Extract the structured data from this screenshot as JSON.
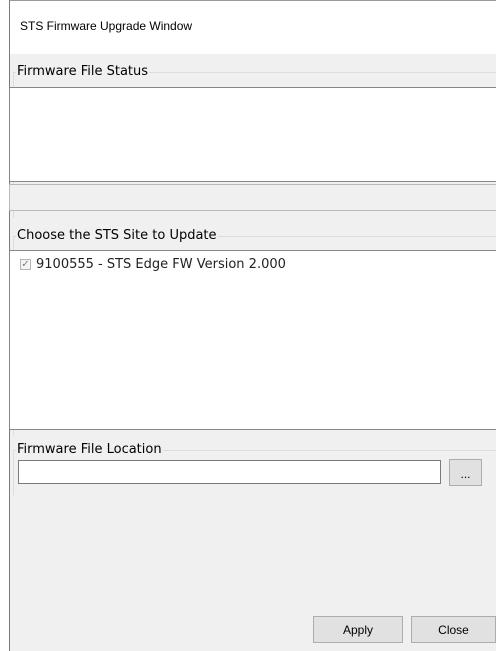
{
  "window": {
    "title": "STS Firmware Upgrade Window"
  },
  "firmware_status": {
    "group_label": "Firmware File Status",
    "text": "",
    "status_text": ""
  },
  "site_selection": {
    "group_label": "Choose the STS Site to Update",
    "items": [
      {
        "label": "9100555 - STS Edge FW Version 2.000",
        "checked": true,
        "enabled": false
      }
    ]
  },
  "file_location": {
    "group_label": "Firmware File Location",
    "value": "",
    "browse_label": "..."
  },
  "actions": {
    "apply_label": "Apply",
    "close_label": "Close"
  }
}
